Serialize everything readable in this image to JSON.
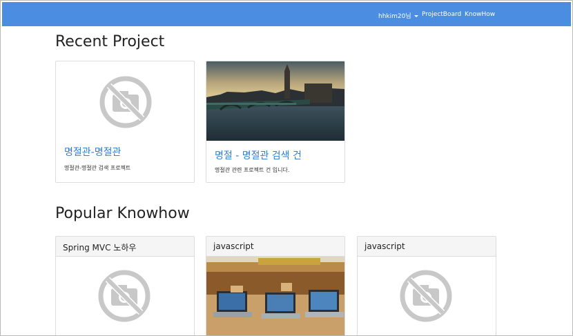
{
  "nav": {
    "user": "hhkim20님",
    "links": [
      "ProjectBoard",
      "KnowHow"
    ],
    "color": "#4b8de0"
  },
  "recent": {
    "title": "Recent Project",
    "cards": [
      {
        "title": "명절관-명절관",
        "desc": "명절관-명절관 검색 프로젝트",
        "image": "no-image-icon"
      },
      {
        "title": "명절 - 명절관 검색 건",
        "desc": "명절관 관련 프로젝트 건 입니다.",
        "image": "london-bridge-photo"
      }
    ]
  },
  "popular": {
    "title": "Popular Knowhow",
    "cards": [
      {
        "title": "Spring MVC 노하우",
        "image": "no-image-icon"
      },
      {
        "title": "javascript",
        "image": "laptops-photo"
      },
      {
        "title": "javascript",
        "image": "no-image-icon"
      }
    ]
  },
  "colors": {
    "link": "#2f7fd0",
    "card_border": "#dcdcdc"
  }
}
